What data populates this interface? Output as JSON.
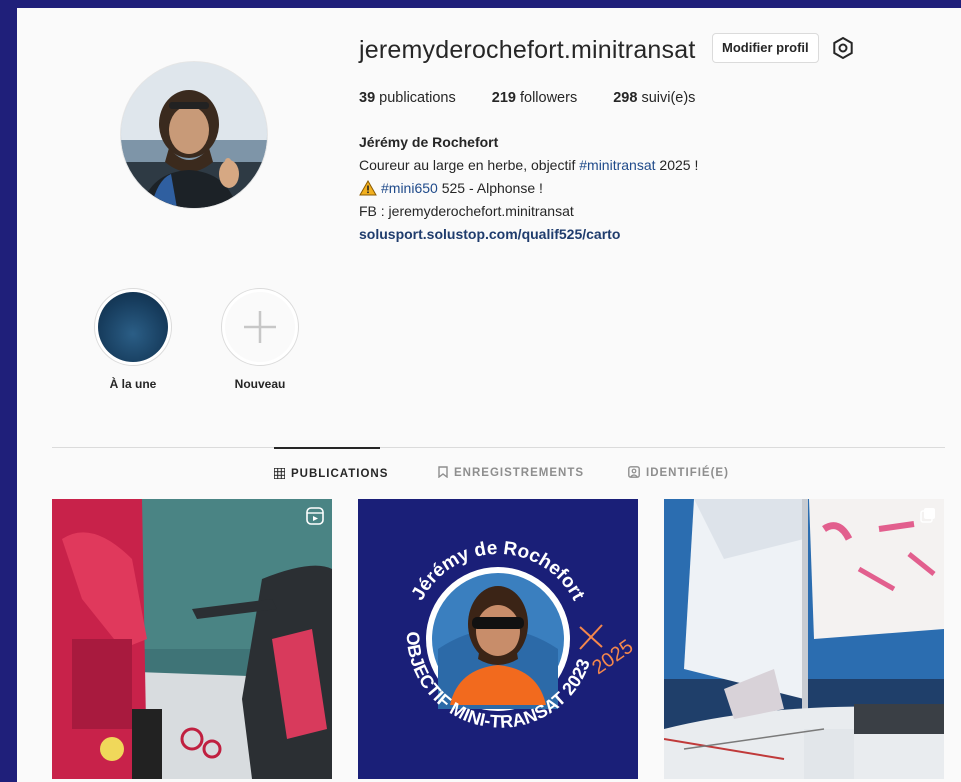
{
  "profile": {
    "username": "jeremyderochefort.minitransat",
    "edit_label": "Modifier profil",
    "stats": [
      {
        "num": "39",
        "label": "publications"
      },
      {
        "num": "219",
        "label": "followers"
      },
      {
        "num": "298",
        "label": "suivi(e)s"
      }
    ],
    "full_name": "Jérémy de Rochefort",
    "bio_line1_prefix": "Coureur au large en herbe, objectif ",
    "bio_line1_tag": "#minitransat",
    "bio_line1_suffix": " 2025 !",
    "bio_line2_tag": "#mini650",
    "bio_line2_suffix": " 525 - Alphonse !",
    "bio_line3": "FB : jeremyderochefort.minitransat",
    "bio_link": "solusport.solustop.com/qualif525/carto"
  },
  "highlights": [
    {
      "label": "À la une"
    },
    {
      "label": "Nouveau"
    }
  ],
  "tabs": [
    {
      "label": "PUBLICATIONS",
      "icon": "grid-icon"
    },
    {
      "label": "ENREGISTREMENTS",
      "icon": "bookmark-icon"
    },
    {
      "label": "IDENTIFIÉ(E)",
      "icon": "tagged-icon"
    }
  ],
  "posts": {
    "post2_arc_text": "Jérémy de Rochefort",
    "post2_bottom_text": "OBJECTIF MINI-TRANSAT 2023",
    "post2_year": "2025"
  }
}
